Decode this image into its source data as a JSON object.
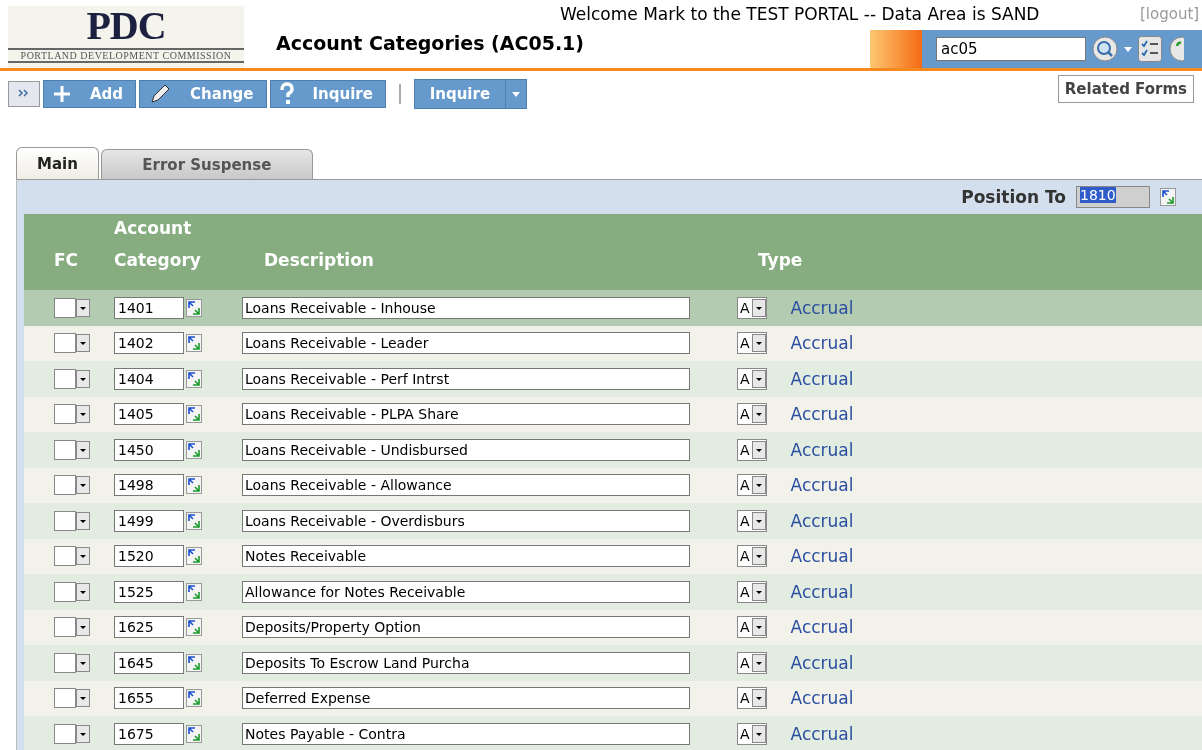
{
  "header": {
    "logo_text": "PDC",
    "logo_subtitle": "PORTLAND DEVELOPMENT COMMISSION",
    "welcome": "Welcome Mark to the TEST PORTAL -- Data Area is SAND",
    "logout": "[logout]",
    "title": "Account Categories (AC05.1)",
    "search_value": "ac05"
  },
  "toolbar": {
    "buttons": [
      {
        "label": "Add",
        "kind": "add"
      },
      {
        "label": "Change",
        "kind": "change"
      },
      {
        "label": "Inquire",
        "kind": "inquire"
      }
    ],
    "split_button": "Inquire",
    "related_forms": "Related Forms"
  },
  "tabs": [
    {
      "label": "Main",
      "selected": true
    },
    {
      "label": "Error Suspense",
      "selected": false
    }
  ],
  "position_to": {
    "label": "Position To",
    "value": "1810"
  },
  "columns": {
    "fc": "FC",
    "account_top": "Account",
    "account_bottom": "Category",
    "description": "Description",
    "type": "Type"
  },
  "rows": [
    {
      "account": "1401",
      "description": "Loans Receivable - Inhouse",
      "type": "A",
      "type_label": "Accrual",
      "selected": true
    },
    {
      "account": "1402",
      "description": "Loans Receivable - Leader",
      "type": "A",
      "type_label": "Accrual",
      "selected": false
    },
    {
      "account": "1404",
      "description": "Loans Receivable - Perf Intrst",
      "type": "A",
      "type_label": "Accrual",
      "selected": false
    },
    {
      "account": "1405",
      "description": "Loans Receivable - PLPA Share",
      "type": "A",
      "type_label": "Accrual",
      "selected": false
    },
    {
      "account": "1450",
      "description": "Loans Receivable - Undisbursed",
      "type": "A",
      "type_label": "Accrual",
      "selected": false
    },
    {
      "account": "1498",
      "description": "Loans Receivable - Allowance",
      "type": "A",
      "type_label": "Accrual",
      "selected": false
    },
    {
      "account": "1499",
      "description": "Loans Receivable - Overdisburs",
      "type": "A",
      "type_label": "Accrual",
      "selected": false
    },
    {
      "account": "1520",
      "description": "Notes Receivable",
      "type": "A",
      "type_label": "Accrual",
      "selected": false
    },
    {
      "account": "1525",
      "description": "Allowance for Notes Receivable",
      "type": "A",
      "type_label": "Accrual",
      "selected": false
    },
    {
      "account": "1625",
      "description": "Deposits/Property Option",
      "type": "A",
      "type_label": "Accrual",
      "selected": false
    },
    {
      "account": "1645",
      "description": "Deposits To Escrow Land Purcha",
      "type": "A",
      "type_label": "Accrual",
      "selected": false
    },
    {
      "account": "1655",
      "description": "Deferred Expense",
      "type": "A",
      "type_label": "Accrual",
      "selected": false
    },
    {
      "account": "1675",
      "description": "Notes Payable - Contra",
      "type": "A",
      "type_label": "Accrual",
      "selected": false
    }
  ]
}
